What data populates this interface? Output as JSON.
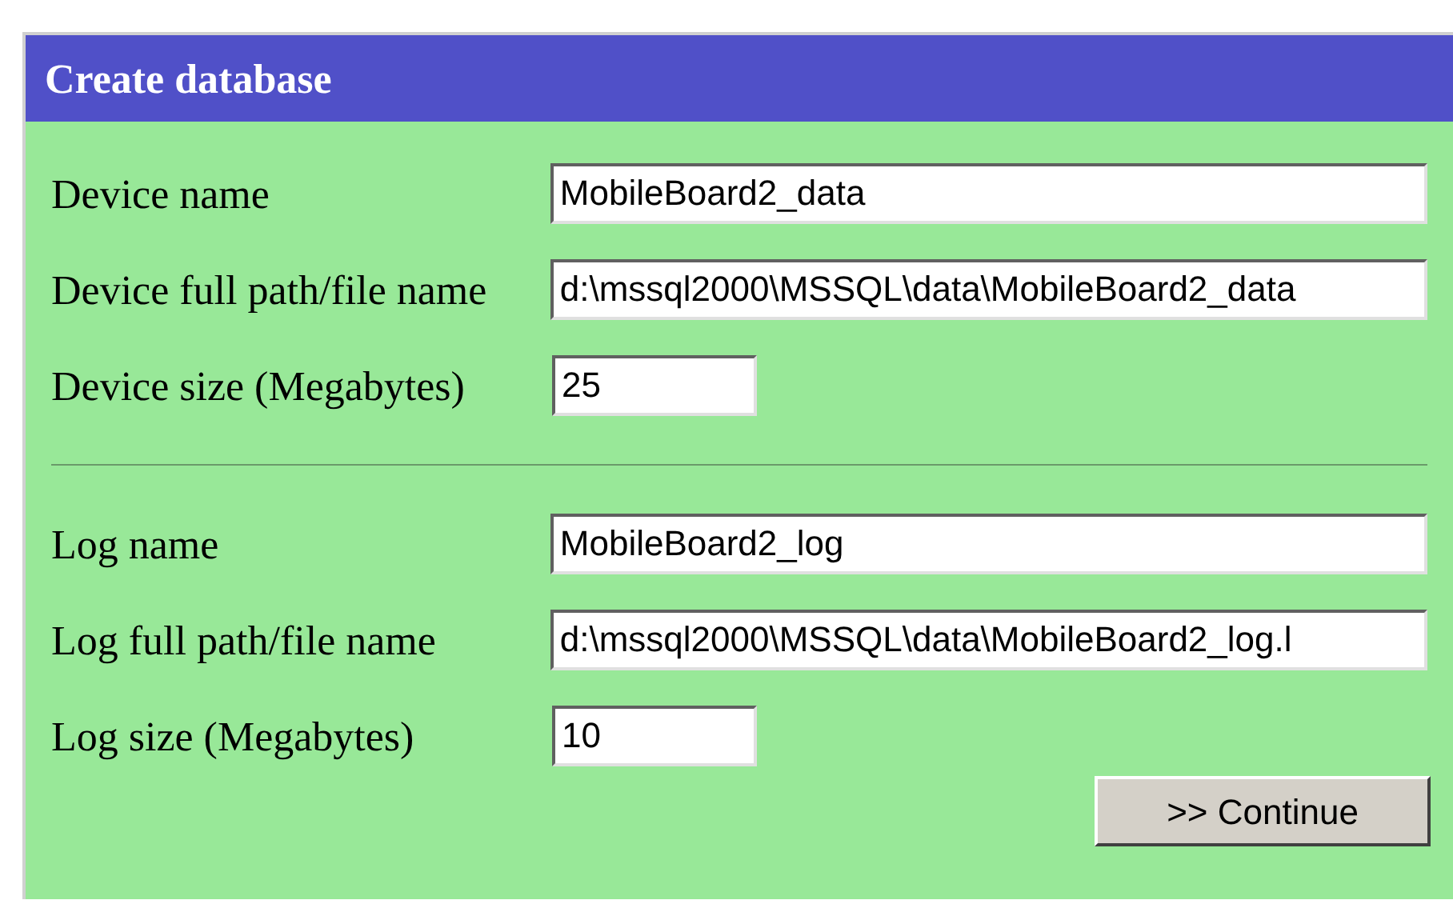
{
  "panel": {
    "title": "Create database"
  },
  "device_fields": [
    {
      "label": "Device name",
      "value": "MobileBoard2_data",
      "kind": "wide"
    },
    {
      "label": "Device full path/file name",
      "value": "d:\\mssql2000\\MSSQL\\data\\MobileBoard2_data",
      "kind": "wide"
    },
    {
      "label": "Device size (Megabytes)",
      "value": "25",
      "kind": "short"
    }
  ],
  "log_fields": [
    {
      "label": "Log name",
      "value": "MobileBoard2_log",
      "kind": "wide"
    },
    {
      "label": "Log full path/file name",
      "value": "d:\\mssql2000\\MSSQL\\data\\MobileBoard2_log.l",
      "kind": "wide"
    },
    {
      "label": "Log size (Megabytes)",
      "value": "10",
      "kind": "short"
    }
  ],
  "button": ">> Continue"
}
